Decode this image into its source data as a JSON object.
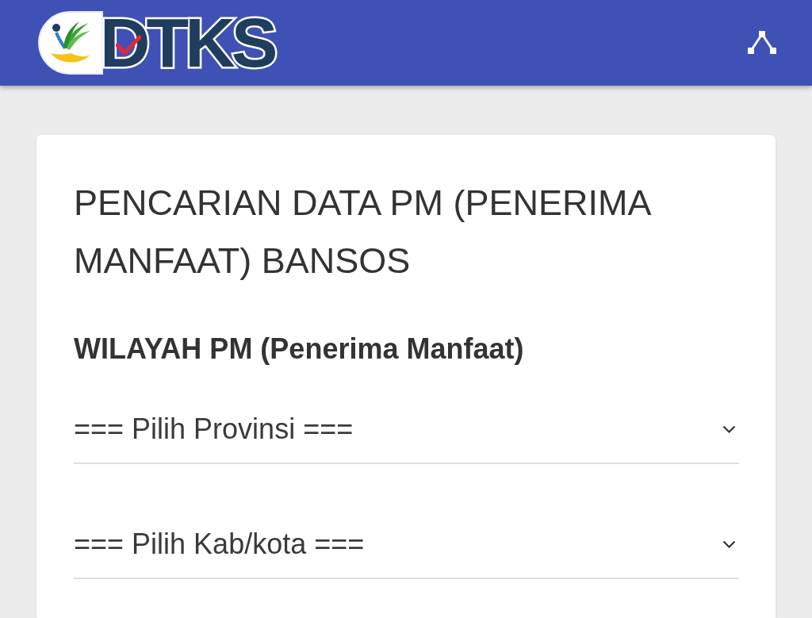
{
  "header": {
    "logo": {
      "text": "DTKS"
    }
  },
  "card": {
    "title": "PENCARIAN DATA PM (PENERIMA MANFAAT) BANSOS",
    "section_label": "WILAYAH PM (Penerima Manfaat)",
    "dropdowns": [
      {
        "value": "=== Pilih Provinsi ==="
      },
      {
        "value": "=== Pilih Kab/kota ==="
      }
    ]
  }
}
